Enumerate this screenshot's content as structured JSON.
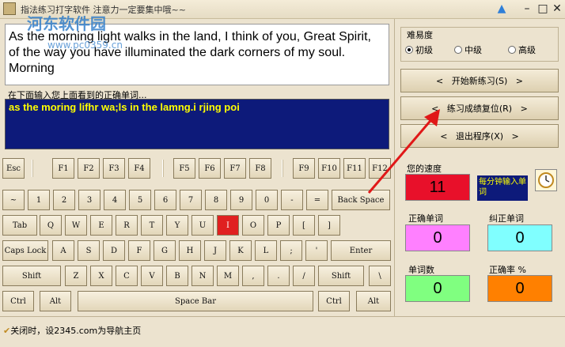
{
  "window": {
    "title": "指法练习打字软件  注意力一定要集中哦~~",
    "watermark": "河东软件园",
    "watermark_url": "www.pc0359.cn"
  },
  "sample_text": "As the morning light walks in the land, I think of you, Great Spirit, of the way you have illuminated the dark corners of my soul. Morning",
  "hint": "在下面输入您上面看到的正确单词...",
  "typed_text": "as the moring lifhr wa;ls in the lamng.i rjing poi",
  "keyboard": {
    "fn_row": [
      "Esc",
      "F1",
      "F2",
      "F3",
      "F4",
      "F5",
      "F6",
      "F7",
      "F8",
      "F9",
      "F10",
      "F11",
      "F12"
    ],
    "num_row": [
      "~",
      "1",
      "2",
      "3",
      "4",
      "5",
      "6",
      "7",
      "8",
      "9",
      "0",
      "-",
      "=",
      "Back Space"
    ],
    "q_row": [
      "Tab",
      "Q",
      "W",
      "E",
      "R",
      "T",
      "Y",
      "U",
      "I",
      "O",
      "P",
      "[",
      "]"
    ],
    "a_row": [
      "Caps Lock",
      "A",
      "S",
      "D",
      "F",
      "G",
      "H",
      "J",
      "K",
      "L",
      ";",
      "'",
      "Enter"
    ],
    "z_row": [
      "Shift",
      "Z",
      "X",
      "C",
      "V",
      "B",
      "N",
      "M",
      ",",
      ".",
      "/",
      "Shift",
      "\\"
    ],
    "bottom_row": [
      "Ctrl",
      "Alt",
      "Space Bar",
      "Ctrl",
      "Alt"
    ],
    "highlighted": "I"
  },
  "difficulty": {
    "title": "难易度",
    "options": [
      "初级",
      "中级",
      "高级"
    ],
    "selected": "初级"
  },
  "buttons": {
    "start": "开始新练习(S)",
    "reset": "练习成绩复位(R)",
    "exit": "退出程序(X)"
  },
  "stats": {
    "speed_label": "您的速度",
    "speed_value": "11",
    "speed_unit": "每分钟输入单词",
    "correct_label": "正确单词",
    "correct_value": "0",
    "corrected_label": "纠正单词",
    "corrected_value": "0",
    "words_label": "单词数",
    "words_value": "0",
    "accuracy_label": "正确率 %",
    "accuracy_value": "0"
  },
  "status": "关闭时，设2345.com为导航主页",
  "colors": {
    "speed_bg": "#e8102a",
    "correct_bg": "#ff80ff",
    "corrected_bg": "#80ffff",
    "words_bg": "#80ff80",
    "accuracy_bg": "#ff8000",
    "typing_bg": "#0d1a7a",
    "typing_fg": "#ffff00"
  }
}
